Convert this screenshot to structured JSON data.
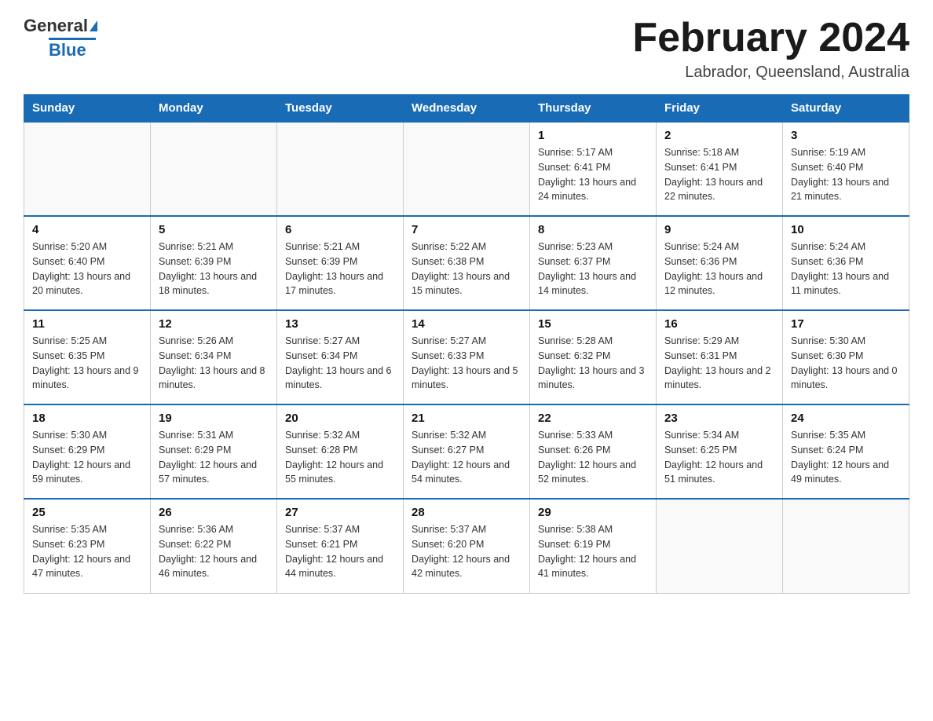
{
  "header": {
    "logo_main": "General",
    "logo_accent": "Blue",
    "month_title": "February 2024",
    "location": "Labrador, Queensland, Australia"
  },
  "days_of_week": [
    "Sunday",
    "Monday",
    "Tuesday",
    "Wednesday",
    "Thursday",
    "Friday",
    "Saturday"
  ],
  "weeks": [
    {
      "days": [
        {
          "num": "",
          "info": ""
        },
        {
          "num": "",
          "info": ""
        },
        {
          "num": "",
          "info": ""
        },
        {
          "num": "",
          "info": ""
        },
        {
          "num": "1",
          "info": "Sunrise: 5:17 AM\nSunset: 6:41 PM\nDaylight: 13 hours and 24 minutes."
        },
        {
          "num": "2",
          "info": "Sunrise: 5:18 AM\nSunset: 6:41 PM\nDaylight: 13 hours and 22 minutes."
        },
        {
          "num": "3",
          "info": "Sunrise: 5:19 AM\nSunset: 6:40 PM\nDaylight: 13 hours and 21 minutes."
        }
      ]
    },
    {
      "days": [
        {
          "num": "4",
          "info": "Sunrise: 5:20 AM\nSunset: 6:40 PM\nDaylight: 13 hours and 20 minutes."
        },
        {
          "num": "5",
          "info": "Sunrise: 5:21 AM\nSunset: 6:39 PM\nDaylight: 13 hours and 18 minutes."
        },
        {
          "num": "6",
          "info": "Sunrise: 5:21 AM\nSunset: 6:39 PM\nDaylight: 13 hours and 17 minutes."
        },
        {
          "num": "7",
          "info": "Sunrise: 5:22 AM\nSunset: 6:38 PM\nDaylight: 13 hours and 15 minutes."
        },
        {
          "num": "8",
          "info": "Sunrise: 5:23 AM\nSunset: 6:37 PM\nDaylight: 13 hours and 14 minutes."
        },
        {
          "num": "9",
          "info": "Sunrise: 5:24 AM\nSunset: 6:36 PM\nDaylight: 13 hours and 12 minutes."
        },
        {
          "num": "10",
          "info": "Sunrise: 5:24 AM\nSunset: 6:36 PM\nDaylight: 13 hours and 11 minutes."
        }
      ]
    },
    {
      "days": [
        {
          "num": "11",
          "info": "Sunrise: 5:25 AM\nSunset: 6:35 PM\nDaylight: 13 hours and 9 minutes."
        },
        {
          "num": "12",
          "info": "Sunrise: 5:26 AM\nSunset: 6:34 PM\nDaylight: 13 hours and 8 minutes."
        },
        {
          "num": "13",
          "info": "Sunrise: 5:27 AM\nSunset: 6:34 PM\nDaylight: 13 hours and 6 minutes."
        },
        {
          "num": "14",
          "info": "Sunrise: 5:27 AM\nSunset: 6:33 PM\nDaylight: 13 hours and 5 minutes."
        },
        {
          "num": "15",
          "info": "Sunrise: 5:28 AM\nSunset: 6:32 PM\nDaylight: 13 hours and 3 minutes."
        },
        {
          "num": "16",
          "info": "Sunrise: 5:29 AM\nSunset: 6:31 PM\nDaylight: 13 hours and 2 minutes."
        },
        {
          "num": "17",
          "info": "Sunrise: 5:30 AM\nSunset: 6:30 PM\nDaylight: 13 hours and 0 minutes."
        }
      ]
    },
    {
      "days": [
        {
          "num": "18",
          "info": "Sunrise: 5:30 AM\nSunset: 6:29 PM\nDaylight: 12 hours and 59 minutes."
        },
        {
          "num": "19",
          "info": "Sunrise: 5:31 AM\nSunset: 6:29 PM\nDaylight: 12 hours and 57 minutes."
        },
        {
          "num": "20",
          "info": "Sunrise: 5:32 AM\nSunset: 6:28 PM\nDaylight: 12 hours and 55 minutes."
        },
        {
          "num": "21",
          "info": "Sunrise: 5:32 AM\nSunset: 6:27 PM\nDaylight: 12 hours and 54 minutes."
        },
        {
          "num": "22",
          "info": "Sunrise: 5:33 AM\nSunset: 6:26 PM\nDaylight: 12 hours and 52 minutes."
        },
        {
          "num": "23",
          "info": "Sunrise: 5:34 AM\nSunset: 6:25 PM\nDaylight: 12 hours and 51 minutes."
        },
        {
          "num": "24",
          "info": "Sunrise: 5:35 AM\nSunset: 6:24 PM\nDaylight: 12 hours and 49 minutes."
        }
      ]
    },
    {
      "days": [
        {
          "num": "25",
          "info": "Sunrise: 5:35 AM\nSunset: 6:23 PM\nDaylight: 12 hours and 47 minutes."
        },
        {
          "num": "26",
          "info": "Sunrise: 5:36 AM\nSunset: 6:22 PM\nDaylight: 12 hours and 46 minutes."
        },
        {
          "num": "27",
          "info": "Sunrise: 5:37 AM\nSunset: 6:21 PM\nDaylight: 12 hours and 44 minutes."
        },
        {
          "num": "28",
          "info": "Sunrise: 5:37 AM\nSunset: 6:20 PM\nDaylight: 12 hours and 42 minutes."
        },
        {
          "num": "29",
          "info": "Sunrise: 5:38 AM\nSunset: 6:19 PM\nDaylight: 12 hours and 41 minutes."
        },
        {
          "num": "",
          "info": ""
        },
        {
          "num": "",
          "info": ""
        }
      ]
    }
  ]
}
